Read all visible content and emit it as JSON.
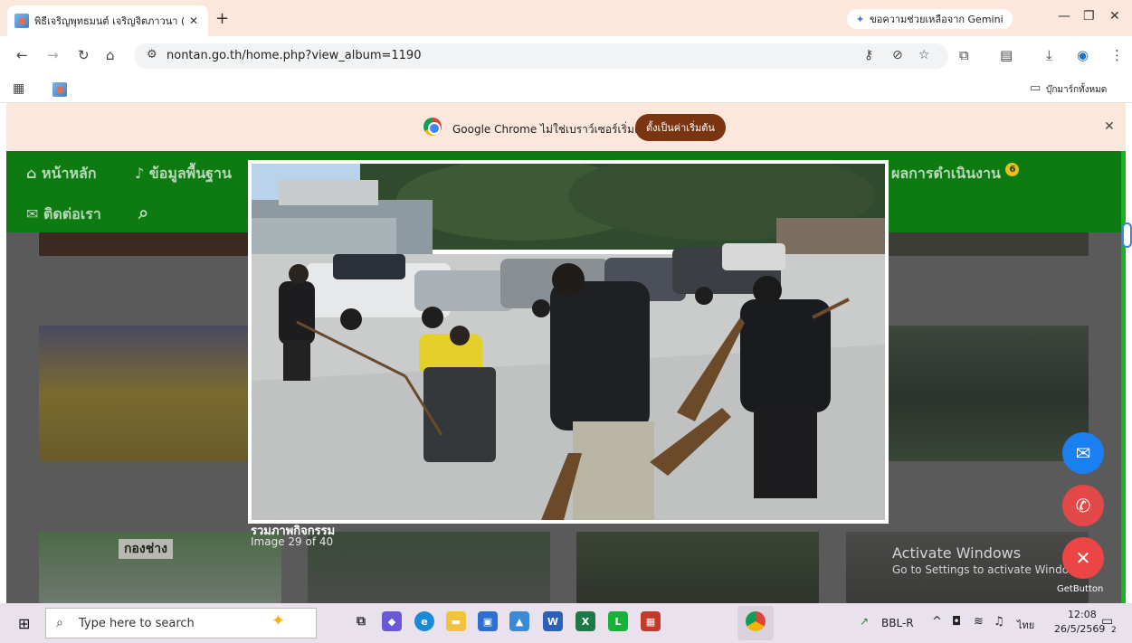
{
  "browser": {
    "tab_title": "พิธีเจริญพุทธมนต์ เจริญจิตภาวนา (ผ",
    "tab_close": "✕",
    "new_tab": "+",
    "gemini_label": "ขอความช่วยเหลือจาก Gemini",
    "window_controls": {
      "minimize": "—",
      "restore": "❐",
      "close": "✕"
    },
    "url": "nontan.go.th/home.php?view_album=1190",
    "all_bookmarks": "บุ๊กมาร์กทั้งหมด"
  },
  "infobar": {
    "message": "Google Chrome ไม่ใช่เบราว์เซอร์เริ่มต้น",
    "button": "ตั้งเป็นค่าเริ่มต้น",
    "close": "✕"
  },
  "site": {
    "nav": {
      "home": "หน้าหลัก",
      "basic_info": "ข้อมูลพื้นฐาน",
      "operations": "ผลการดำเนินงาน",
      "operations_badge": "6",
      "contact": "ติดต่อเรา"
    },
    "colors": {
      "nav_bg": "#0e7a12",
      "accent_green": "#0fb81b"
    }
  },
  "lightbox": {
    "title": "รวมภาพกิจกรรม",
    "counter": "Image 29 of 40"
  },
  "gallery": {
    "sign_text": "กองช่าง"
  },
  "overlay": {
    "activate_title": "Activate Windows",
    "activate_sub": "Go to Settings to activate Windo",
    "getbutton": "GetButton"
  },
  "taskbar": {
    "search_placeholder": "Type here to search",
    "tray_network_label": "BBL-R",
    "language": "ไทย",
    "time": "12:08",
    "date": "26/5/2569",
    "notification_count": "2"
  }
}
